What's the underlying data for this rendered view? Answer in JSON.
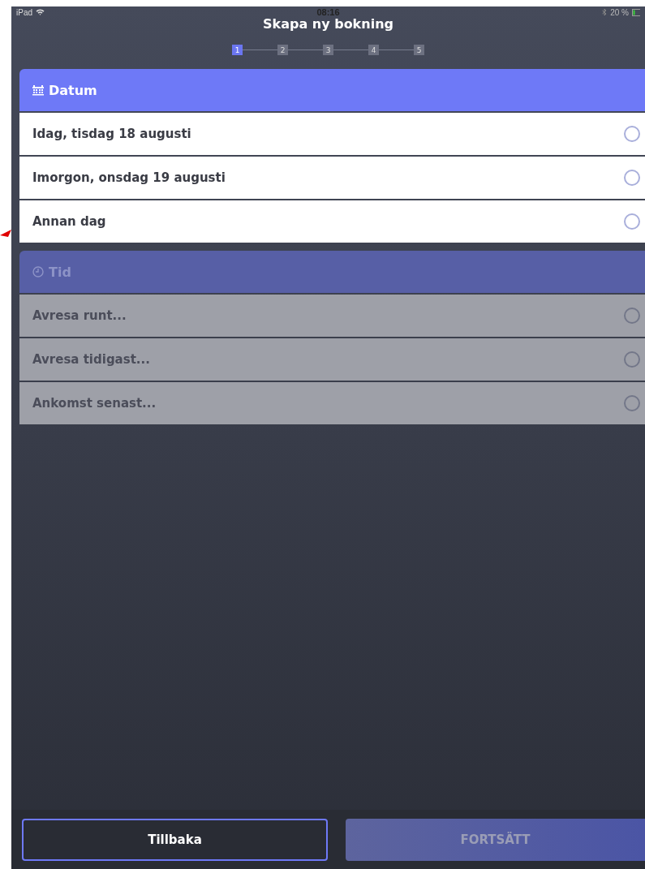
{
  "status_bar": {
    "device": "iPad",
    "time": "08:16",
    "battery": "20 %"
  },
  "title": "Skapa ny bokning",
  "steps": [
    {
      "label": "1",
      "selected": true
    },
    {
      "label": "2",
      "selected": false
    },
    {
      "label": "3",
      "selected": false
    },
    {
      "label": "4",
      "selected": false
    },
    {
      "label": "5",
      "selected": false
    }
  ],
  "sections": [
    {
      "kind": "date",
      "title": "Datum",
      "disabled": false,
      "options": [
        {
          "label": "Idag, tisdag 18 augusti",
          "selected": false
        },
        {
          "label": "Imorgon, onsdag 19 augusti",
          "selected": false
        },
        {
          "label": "Annan dag",
          "selected": false
        }
      ]
    },
    {
      "kind": "time",
      "title": "Tid",
      "disabled": true,
      "options": [
        {
          "label": "Avresa runt...",
          "selected": false
        },
        {
          "label": "Avresa tidigast...",
          "selected": false
        },
        {
          "label": "Ankomst senast...",
          "selected": false
        }
      ]
    }
  ],
  "buttons": [
    {
      "label": "Tillbaka",
      "disabled": false
    },
    {
      "label": "FORTSÄTT",
      "disabled": true
    }
  ]
}
